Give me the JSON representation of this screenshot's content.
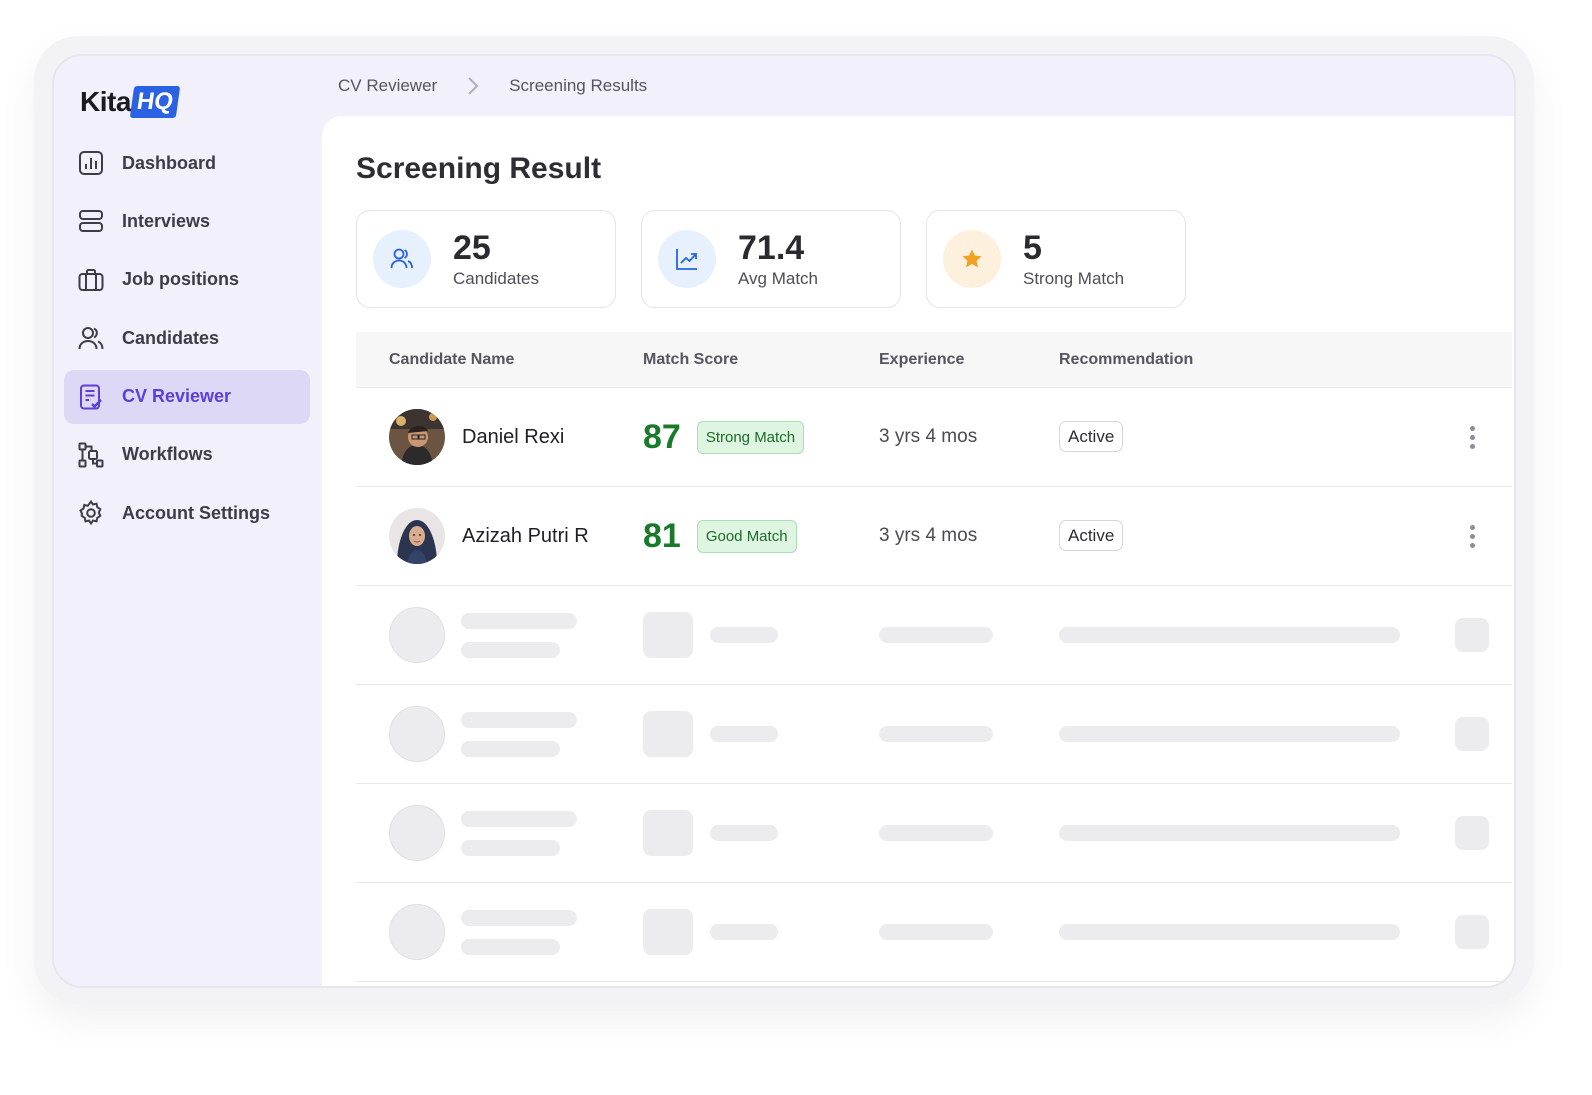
{
  "brand": {
    "logo_text": "Kita",
    "logo_highlight": "HQ"
  },
  "sidebar": {
    "items": [
      {
        "label": "Dashboard",
        "icon": "chart-icon"
      },
      {
        "label": "Interviews",
        "icon": "server-icon"
      },
      {
        "label": "Job positions",
        "icon": "briefcase-icon"
      },
      {
        "label": "Candidates",
        "icon": "users-icon"
      },
      {
        "label": "CV Reviewer",
        "icon": "document-check-icon",
        "active": true
      },
      {
        "label": "Workflows",
        "icon": "workflow-icon"
      },
      {
        "label": "Account Settings",
        "icon": "gear-icon"
      }
    ]
  },
  "breadcrumb": {
    "parent": "CV Reviewer",
    "current": "Screening Results"
  },
  "page": {
    "title": "Screening Result"
  },
  "stats": [
    {
      "value": "25",
      "caption": "Candidates",
      "icon": "users-icon",
      "bg": "#e6f1fd",
      "color": "#2a62e3"
    },
    {
      "value": "71.4",
      "caption": "Avg Match",
      "icon": "trend-up-icon",
      "bg": "#e6f1fd",
      "color": "#2a62e3"
    },
    {
      "value": "5",
      "caption": "Strong Match",
      "icon": "star-icon",
      "bg": "#fdf0dd",
      "color": "#f3a124"
    }
  ],
  "table": {
    "columns": {
      "name": "Candidate Name",
      "score": "Match Score",
      "experience": "Experience",
      "recommendation": "Recommendation"
    },
    "rows": [
      {
        "name": "Daniel Rexi",
        "score": "87",
        "match": "Strong Match",
        "experience": "3 yrs 4 mos",
        "status": "Active"
      },
      {
        "name": "Azizah Putri R",
        "score": "81",
        "match": "Good Match",
        "experience": "3 yrs 4 mos",
        "status": "Active"
      }
    ]
  },
  "colors": {
    "accent": "#5b3fd6",
    "brand_blue": "#2a62e3",
    "score_green": "#1a7a2c",
    "sidebar_bg": "#f1f0fb"
  }
}
